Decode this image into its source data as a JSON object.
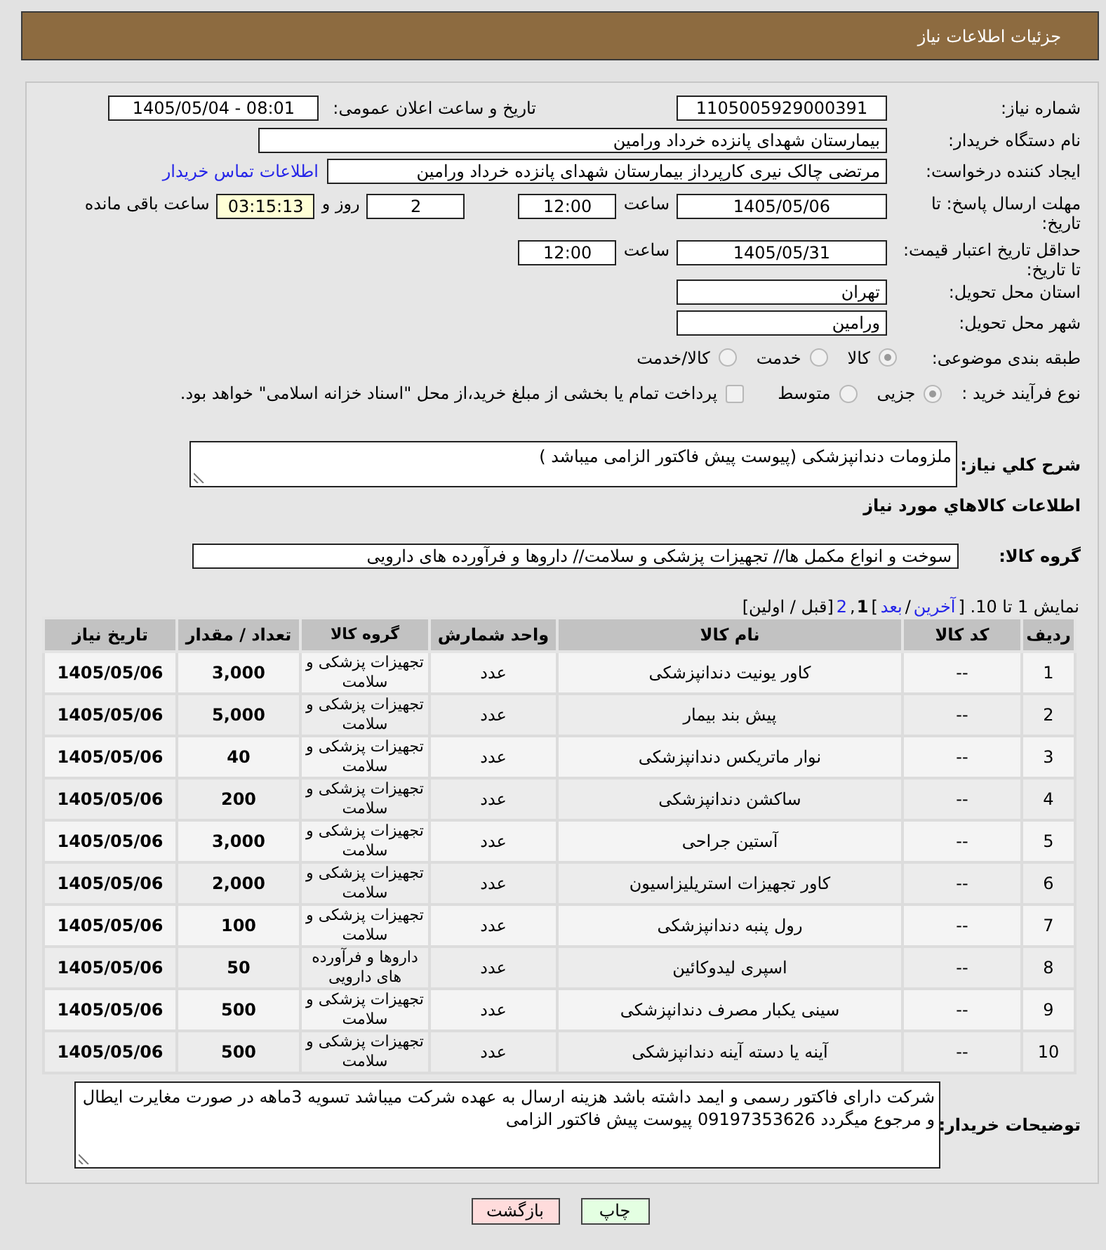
{
  "header": {
    "title": "جزئیات اطلاعات نیاز"
  },
  "details": {
    "need_number": {
      "label": "شماره نیاز:",
      "value": "1105005929000391"
    },
    "announce": {
      "label": "تاریخ و ساعت اعلان عمومی:",
      "value": "1405/05/04 - 08:01"
    },
    "buyer_org": {
      "label": "نام دستگاه خریدار:",
      "value": "بیمارستان شهدای پانزده خرداد ورامین"
    },
    "requester": {
      "label": "ایجاد کننده درخواست:",
      "value": "مرتضی چالک نیری کارپرداز بیمارستان شهدای پانزده خرداد ورامین",
      "link": "اطلاعات تماس خریدار"
    },
    "deadline": {
      "label": "مهلت ارسال پاسخ: تا تاریخ:",
      "date": "1405/05/06",
      "time_label": "ساعت",
      "time": "12:00",
      "days": "2",
      "days_label": "روز و",
      "remaining": "03:15:13",
      "remaining_label": "ساعت باقی مانده"
    },
    "validity": {
      "label": "حداقل تاریخ اعتبار قیمت: تا تاریخ:",
      "date": "1405/05/31",
      "time_label": "ساعت",
      "time": "12:00"
    },
    "province": {
      "label": "استان محل تحویل:",
      "value": "تهران"
    },
    "city": {
      "label": "شهر محل تحویل:",
      "value": "ورامین"
    },
    "category": {
      "label": "طبقه بندی موضوعی:",
      "options": [
        {
          "label": "کالا",
          "selected": true
        },
        {
          "label": "خدمت",
          "selected": false
        },
        {
          "label": "کالا/خدمت",
          "selected": false
        }
      ]
    },
    "process": {
      "label": "نوع فرآیند خرید :",
      "options": [
        {
          "label": "جزیی",
          "selected": true
        },
        {
          "label": "متوسط",
          "selected": false
        }
      ],
      "treasury": {
        "label": "پرداخت تمام یا بخشی از مبلغ خرید،از محل \"اسناد خزانه اسلامی\" خواهد بود.",
        "checked": false
      }
    }
  },
  "description": {
    "label": "شرح کلي نياز:",
    "value": "ملزومات دندانپزشکی (پیوست پیش فاکتور الزامی میباشد )"
  },
  "goods_heading": "اطلاعات کالاهاي مورد نياز",
  "goods_group": {
    "label": "گروه کالا:",
    "value": "سوخت و انواع مکمل ها// تجهیزات پزشکی و سلامت// داروها و فرآورده های دارویی"
  },
  "pager": [
    {
      "kind": "text",
      "text": "نمایش 1 تا 10. ["
    },
    {
      "kind": "link",
      "text": "آخرین"
    },
    {
      "kind": "text",
      "text": "/"
    },
    {
      "kind": "link",
      "text": "بعد"
    },
    {
      "kind": "text",
      "text": "]"
    },
    {
      "kind": "link",
      "text": "2"
    },
    {
      "kind": "text",
      "text": ","
    },
    {
      "kind": "current",
      "text": "1"
    },
    {
      "kind": "text",
      "text": "[قبل / اولین]"
    }
  ],
  "table": {
    "columns": [
      "ردیف",
      "کد کالا",
      "نام کالا",
      "واحد شمارش",
      "گروه کالا",
      "تعداد / مقدار",
      "تاریخ نیاز"
    ],
    "rows": [
      {
        "cells": [
          "1",
          "--",
          "کاور یونیت دندانپزشکی",
          "عدد",
          "تجهیزات پزشکی و سلامت",
          "3,000",
          "1405/05/06"
        ]
      },
      {
        "cells": [
          "2",
          "--",
          "پیش بند بیمار",
          "عدد",
          "تجهیزات پزشکی و سلامت",
          "5,000",
          "1405/05/06"
        ]
      },
      {
        "cells": [
          "3",
          "--",
          "نوار ماتریکس دندانپزشکی",
          "عدد",
          "تجهیزات پزشکی و سلامت",
          "40",
          "1405/05/06"
        ]
      },
      {
        "cells": [
          "4",
          "--",
          "ساکشن دندانپزشکی",
          "عدد",
          "تجهیزات پزشکی و سلامت",
          "200",
          "1405/05/06"
        ]
      },
      {
        "cells": [
          "5",
          "--",
          "آستین جراحی",
          "عدد",
          "تجهیزات پزشکی و سلامت",
          "3,000",
          "1405/05/06"
        ]
      },
      {
        "cells": [
          "6",
          "--",
          "کاور تجهیزات استریلیزاسیون",
          "عدد",
          "تجهیزات پزشکی و سلامت",
          "2,000",
          "1405/05/06"
        ]
      },
      {
        "cells": [
          "7",
          "--",
          "رول پنبه دندانپزشکی",
          "عدد",
          "تجهیزات پزشکی و سلامت",
          "100",
          "1405/05/06"
        ]
      },
      {
        "cells": [
          "8",
          "--",
          "اسپری لیدوکائین",
          "عدد",
          "داروها و فرآورده های دارویی",
          "50",
          "1405/05/06"
        ]
      },
      {
        "cells": [
          "9",
          "--",
          "سینی یکبار مصرف دندانپزشکی",
          "عدد",
          "تجهیزات پزشکی و سلامت",
          "500",
          "1405/05/06"
        ]
      },
      {
        "cells": [
          "10",
          "--",
          "آینه یا دسته آینه دندانپزشکی",
          "عدد",
          "تجهیزات پزشکی و سلامت",
          "500",
          "1405/05/06"
        ]
      }
    ]
  },
  "buyer_notes": {
    "label": "توضیحات خریدار:",
    "value": "شرکت دارای فاکتور رسمی و ایمد داشته باشد هزینه ارسال به عهده شرکت میباشد تسویه 3ماهه در صورت مغایرت ایطال و مرجوع میگردد 09197353626 پیوست پیش فاکتور الزامی"
  },
  "buttons": [
    {
      "kind": "print",
      "label": "چاپ"
    },
    {
      "kind": "back",
      "label": "بازگشت"
    }
  ]
}
